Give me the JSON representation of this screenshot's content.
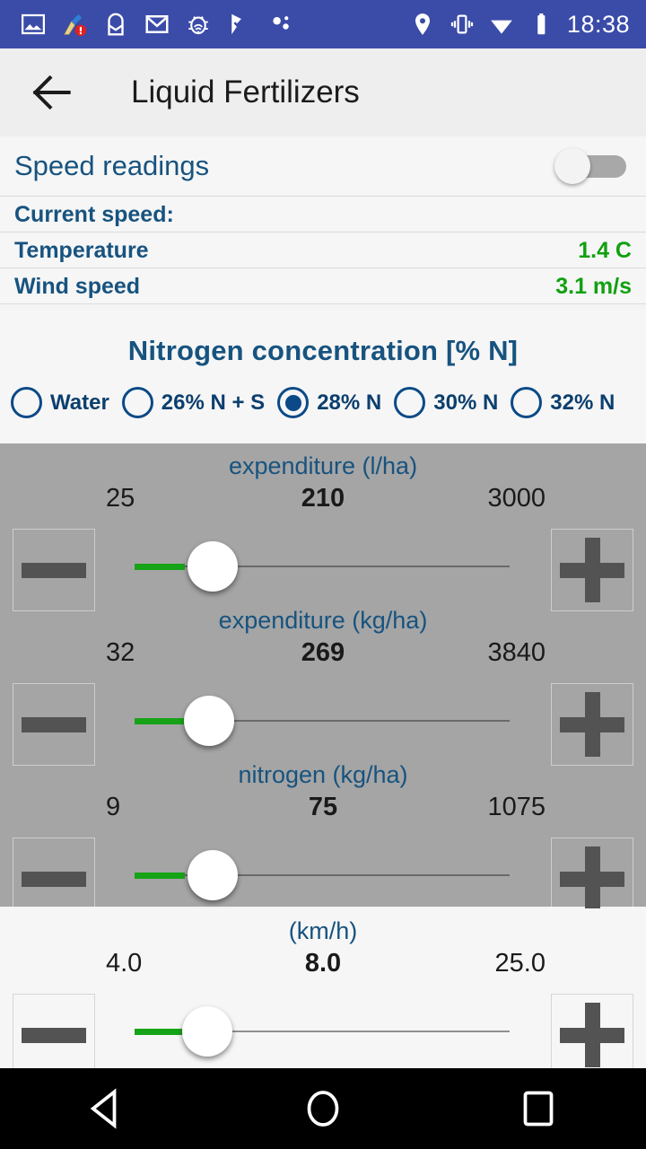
{
  "statusbar": {
    "time": "18:38",
    "left_icons": [
      "image-icon",
      "broom-alert-icon",
      "mail-envelope-icon",
      "gmail-icon",
      "debug-bug-icon",
      "check-flag-icon",
      "dots-icon"
    ],
    "right_icons": [
      "location-pin-icon",
      "vibrate-icon",
      "wifi-icon",
      "battery-icon"
    ],
    "background": "#3b4ba8"
  },
  "appbar": {
    "back_icon": "arrow-back-icon",
    "title": "Liquid Fertilizers"
  },
  "speed_section": {
    "header_label": "Speed readings",
    "toggle_state": "off",
    "rows": [
      {
        "label": "Current speed:",
        "value": ""
      },
      {
        "label": "Temperature",
        "value": "1.4 C"
      },
      {
        "label": "Wind speed",
        "value": "3.1 m/s"
      }
    ],
    "label_color": "#17537f",
    "value_color": "#11a011"
  },
  "nitrogen_section": {
    "title": "Nitrogen concentration [% N]",
    "options": [
      {
        "label": "Water",
        "selected": false
      },
      {
        "label": "26% N + S",
        "selected": false
      },
      {
        "label": "28% N",
        "selected": true
      },
      {
        "label": "30% N",
        "selected": false
      },
      {
        "label": "32% N",
        "selected": false
      }
    ],
    "accent": "#0b4a87"
  },
  "sliders": [
    {
      "title": "expenditure (l/ha)",
      "min": "25",
      "current": "210",
      "max": "3000",
      "minus_icon": "minus-icon",
      "plus_icon": "plus-icon",
      "fill_color": "#17a317"
    },
    {
      "title": "expenditure (kg/ha)",
      "min": "32",
      "current": "269",
      "max": "3840",
      "minus_icon": "minus-icon",
      "plus_icon": "plus-icon",
      "fill_color": "#17a317"
    },
    {
      "title": "nitrogen (kg/ha)",
      "min": "9",
      "current": "75",
      "max": "1075",
      "minus_icon": "minus-icon",
      "plus_icon": "plus-icon",
      "fill_color": "#17a317"
    },
    {
      "title": "(km/h)",
      "min": "4.0",
      "current": "8.0",
      "max": "25.0",
      "minus_icon": "minus-icon",
      "plus_icon": "plus-icon",
      "fill_color": "#17a317"
    }
  ],
  "navbar": {
    "back": "nav-back-icon",
    "home": "nav-home-icon",
    "recents": "nav-recents-icon"
  }
}
